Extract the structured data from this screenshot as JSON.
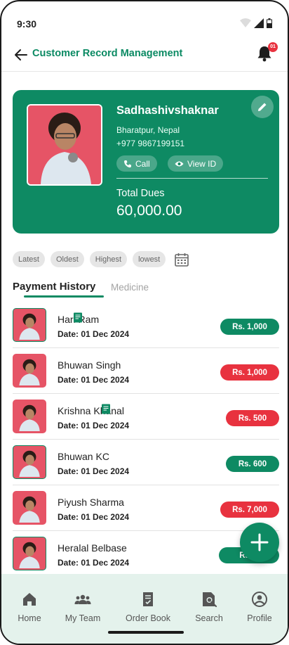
{
  "status_bar": {
    "time": "9:30"
  },
  "app_bar": {
    "title": "Customer Record Management",
    "notification_count": "01"
  },
  "profile": {
    "name": "Sadhashivshaknar",
    "address": "Bharatpur, Nepal",
    "phone": "+977 9867199151",
    "call_label": "Call",
    "view_id_label": "View ID",
    "dues_label": "Total Dues",
    "dues_value": "60,000.00"
  },
  "filters": [
    "Latest",
    "Oldest",
    "Highest",
    "lowest"
  ],
  "tabs": {
    "active": "Payment History",
    "inactive": "Medicine"
  },
  "records": [
    {
      "name": "Hari Ram",
      "date": "Date: 01 Dec 2024",
      "amount": "Rs. 1,000",
      "status": "paid",
      "has_doc": true
    },
    {
      "name": "Bhuwan Singh",
      "date": "Date: 01 Dec 2024",
      "amount": "Rs. 1,000",
      "status": "due",
      "has_doc": false
    },
    {
      "name": "Krishna Khanal",
      "date": "Date: 01 Dec 2024",
      "amount": "Rs. 500",
      "status": "due",
      "has_doc": true
    },
    {
      "name": "Bhuwan KC",
      "date": "Date: 01 Dec 2024",
      "amount": "Rs. 600",
      "status": "paid",
      "has_doc": false
    },
    {
      "name": "Piyush Sharma",
      "date": "Date: 01 Dec 2024",
      "amount": "Rs. 7,000",
      "status": "due",
      "has_doc": false
    },
    {
      "name": "Heralal Belbase",
      "date": "Date: 01 Dec 2024",
      "amount": "Rs. 3",
      "status": "paid",
      "has_doc": false
    }
  ],
  "bottom_nav": [
    {
      "label": "Home",
      "icon": "home-icon"
    },
    {
      "label": "My Team",
      "icon": "team-icon"
    },
    {
      "label": "Order Book",
      "icon": "order-book-icon"
    },
    {
      "label": "Search",
      "icon": "search-icon"
    },
    {
      "label": "Profile",
      "icon": "profile-icon"
    }
  ],
  "colors": {
    "primary": "#0e8a63",
    "due": "#e8323f",
    "paid": "#0e8a63",
    "nav_bg": "#e4f2ec"
  }
}
